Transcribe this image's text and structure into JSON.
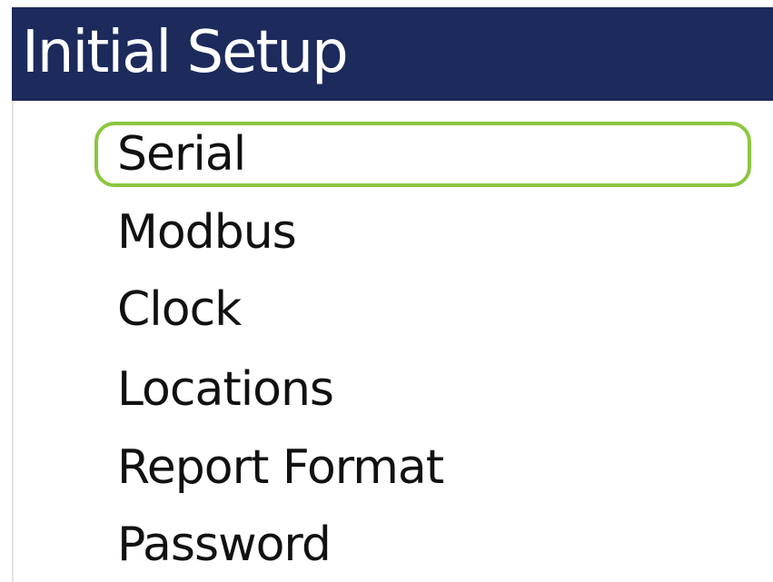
{
  "header": {
    "title": "Initial Setup"
  },
  "menu": {
    "selected_index": 0,
    "highlight_color": "#8cc63f",
    "items": [
      {
        "label": "Serial"
      },
      {
        "label": "Modbus"
      },
      {
        "label": "Clock"
      },
      {
        "label": "Locations"
      },
      {
        "label": "Report Format"
      },
      {
        "label": "Password"
      }
    ]
  },
  "colors": {
    "header_background": "#1c2a5c",
    "header_text": "#ffffff",
    "item_text": "#111111"
  }
}
